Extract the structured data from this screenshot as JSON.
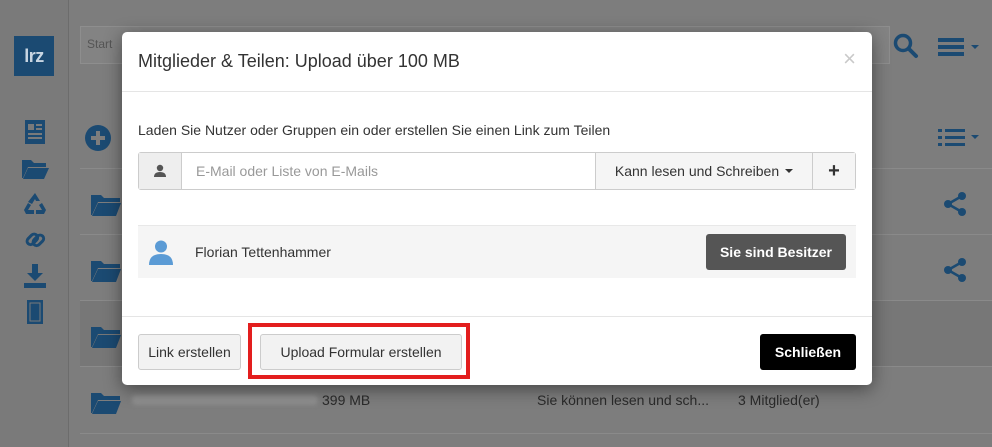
{
  "app": {
    "logo_text": "lrz",
    "search_placeholder": "Start"
  },
  "background_rows": [
    {
      "size": "",
      "permission": "",
      "members": ""
    },
    {
      "size": "",
      "permission": "",
      "members": ""
    },
    {
      "size": "",
      "permission": "",
      "members": ""
    },
    {
      "size": "399 MB",
      "permission": "Sie können lesen und sch...",
      "members": "3 Mitglied(er)"
    }
  ],
  "modal": {
    "title": "Mitglieder & Teilen: Upload über 100 MB",
    "close_glyph": "×",
    "intro": "Laden Sie Nutzer oder Gruppen ein oder erstellen Sie einen Link zum Teilen",
    "email_placeholder": "E-Mail oder Liste von E-Mails",
    "permission_label": "Kann lesen und Schreiben",
    "add_glyph": "+",
    "member": {
      "name": "Florian Tettenhammer",
      "role_label": "Sie sind Besitzer"
    },
    "footer": {
      "link_button": "Link erstellen",
      "upload_form_button": "Upload Formular erstellen",
      "close_button": "Schließen"
    }
  },
  "colors": {
    "highlight": "#e31e1e",
    "logo_bg": "#1b4a72",
    "accent_icon": "#1b4a72"
  }
}
